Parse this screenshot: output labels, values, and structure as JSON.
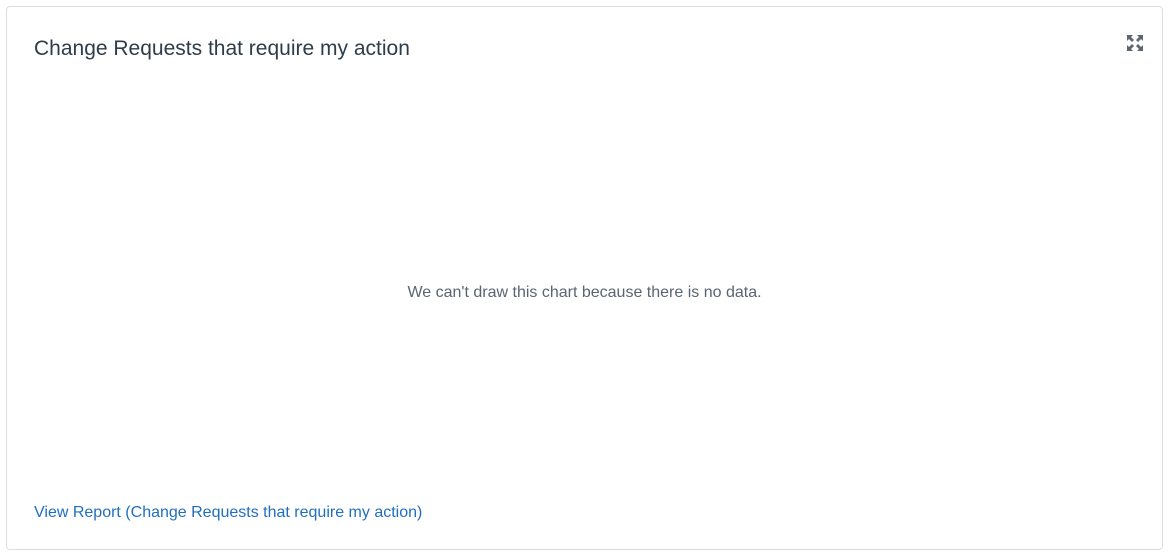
{
  "widget": {
    "title": "Change Requests that require my action",
    "expand_icon": "expand-icon",
    "empty_message": "We can't draw this chart because there is no data.",
    "report_link_label": "View Report (Change Requests that require my action)"
  },
  "colors": {
    "title": "#2e3d49",
    "message": "#5a6570",
    "link": "#1f6fbf",
    "border": "#dadde2",
    "icon": "#5b6670"
  }
}
